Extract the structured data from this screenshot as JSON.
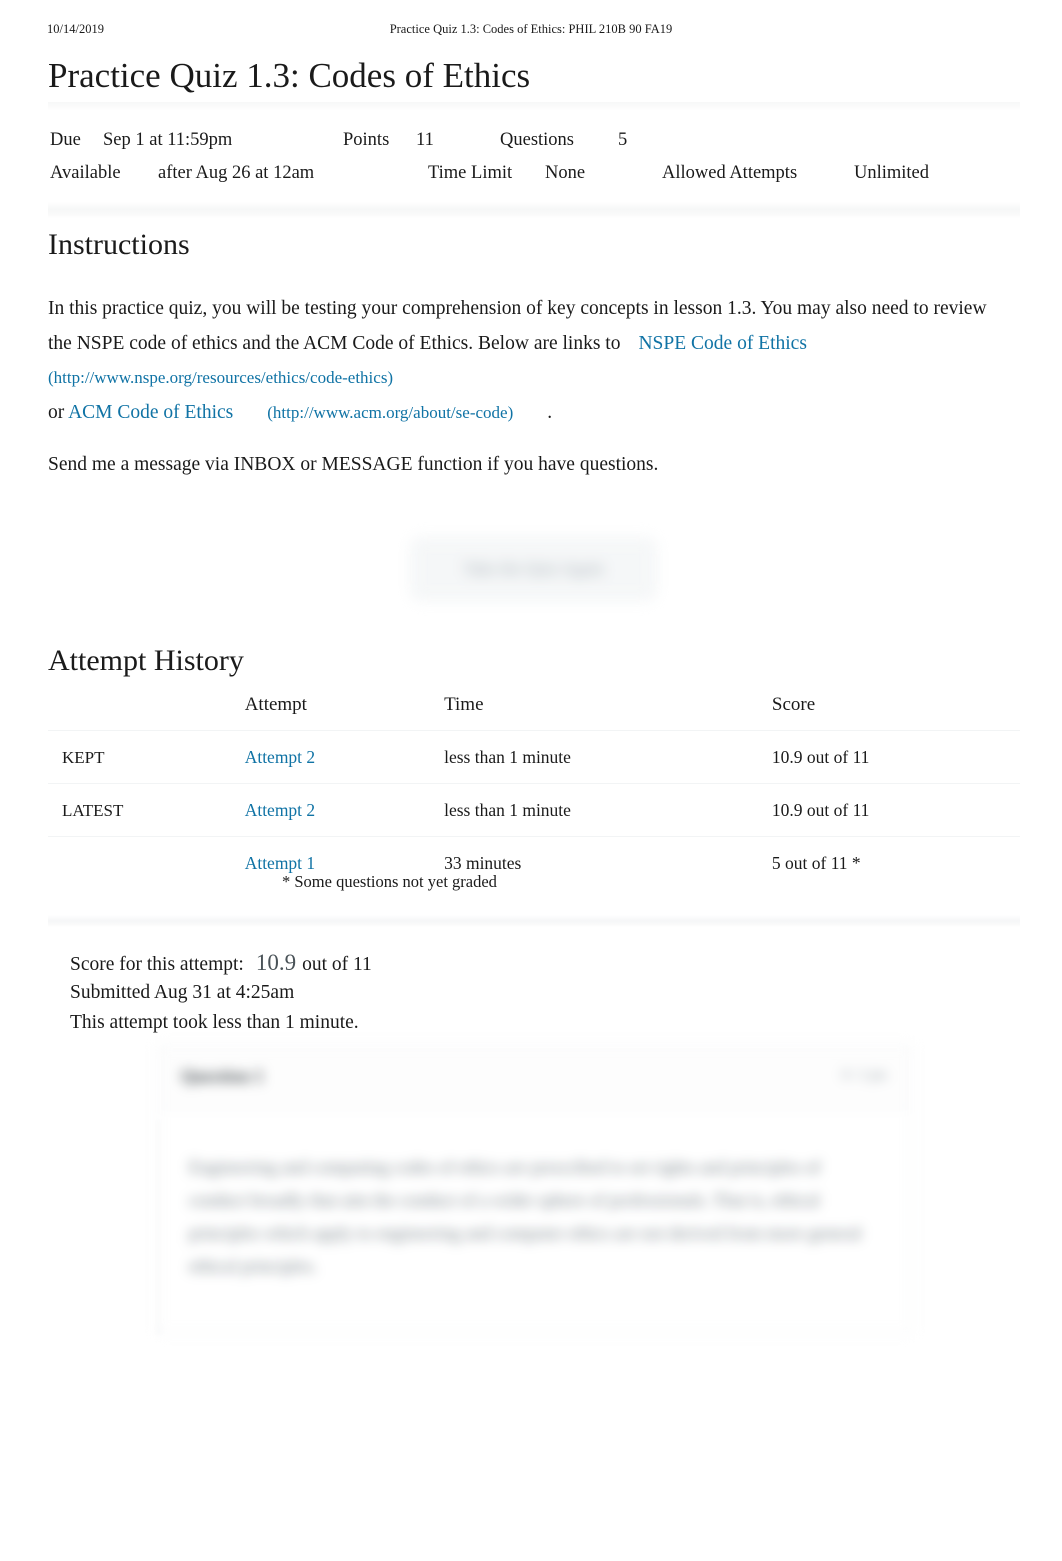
{
  "print_header": {
    "date": "10/14/2019",
    "title": "Practice Quiz 1.3: Codes of Ethics: PHIL 210B 90 FA19"
  },
  "quiz": {
    "title": "Practice Quiz 1.3: Codes of Ethics",
    "details": [
      {
        "label": "Due",
        "value": "Sep 1 at 11:59pm"
      },
      {
        "label": "Points",
        "value": "11"
      },
      {
        "label": "Questions",
        "value": "5"
      },
      {
        "label": "Available",
        "value": "after Aug 26 at 12am"
      },
      {
        "label": "Time Limit",
        "value": "None"
      },
      {
        "label": "Allowed Attempts",
        "value": "Unlimited"
      }
    ]
  },
  "instructions": {
    "heading": "Instructions",
    "paragraph_1_part_1": "In this practice quiz, you will be testing your comprehension of key concepts in lesson 1.3.",
    "paragraph_1_part_2": "You may also need to review the NSPE code of ethics and the ACM Code of Ethics. Below",
    "paragraph_1_part_3": "are links to",
    "nspe_link_text": "NSPE Code of Ethics",
    "nspe_link_url": "(http://www.nspe.org/resources/ethics/code-ethics)",
    "or_text": "or",
    "acm_link_text": "ACM Code of Ethics",
    "acm_link_url": "(http://www.acm.org/about/se-code)",
    "period": ".",
    "paragraph_2": "Send me a message via INBOX or MESSAGE function if you have questions."
  },
  "retake_button": {
    "label": "Take the Quiz Again"
  },
  "attempt_history": {
    "heading": "Attempt History",
    "columns": [
      "",
      "Attempt",
      "Time",
      "Score"
    ],
    "rows": [
      {
        "kept": "KEPT",
        "attempt": "Attempt 2",
        "time": "less than 1 minute",
        "score": "10.9 out of 11"
      },
      {
        "kept": "LATEST",
        "attempt": "Attempt 2",
        "time": "less than 1 minute",
        "score": "10.9 out of 11"
      },
      {
        "kept": "",
        "attempt": "Attempt 1",
        "time": "33 minutes",
        "score": "5 out of 11 *"
      }
    ],
    "footnote": "* Some questions not yet graded"
  },
  "score_summary": {
    "score_label": "Score for this attempt:",
    "score_value": "10.9",
    "score_out_of": "out of 11",
    "submitted": "Submitted Aug 31 at 4:25am",
    "duration": "This attempt took less than 1 minute."
  },
  "question_card": {
    "title": "Question 1",
    "points": "0 / 2 pts",
    "body": "Engineering and computing codes of ethics are prescribed to set rights and principles of conduct broadly that aim the conduct of a wider sphere of professionals. That is, ethical principles which apply to engineering and computer ethics are not derived from more general ethical principles."
  },
  "colors": {
    "link": "#1073a5",
    "text": "#1a1a1a",
    "muted": "#4a5358",
    "rule": "#f2f4f5"
  }
}
